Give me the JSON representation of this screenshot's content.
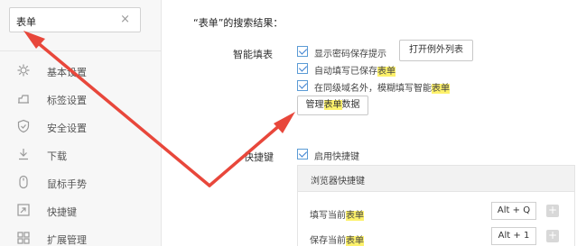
{
  "search": {
    "value": "表单",
    "clear": "×"
  },
  "sidebar": {
    "items": [
      {
        "label": "基本设置",
        "icon": "gear-icon"
      },
      {
        "label": "标签设置",
        "icon": "tab-icon"
      },
      {
        "label": "安全设置",
        "icon": "shield-icon"
      },
      {
        "label": "下载",
        "icon": "download-icon"
      },
      {
        "label": "鼠标手势",
        "icon": "mouse-icon"
      },
      {
        "label": "快捷键",
        "icon": "shortcut-icon"
      },
      {
        "label": "扩展管理",
        "icon": "extension-icon"
      }
    ]
  },
  "main": {
    "result_title": "“表单”的搜索结果：",
    "autofill": {
      "label": "智能填表",
      "opt1": "显示密码保存提示",
      "exceptions_button": "打开例外列表",
      "opt2_prefix": "自动填写已保存",
      "opt2_highlight": "表单",
      "opt3_prefix": "在同级域名外，模糊填写智能",
      "opt3_highlight": "表单",
      "manage_prefix": "管理",
      "manage_highlight": "表单",
      "manage_suffix": "数据"
    },
    "shortcuts": {
      "label": "快捷键",
      "enable": "启用快捷键",
      "header": "浏览器快捷键",
      "rows": [
        {
          "prefix": "填写当前",
          "highlight": "表单",
          "key": "Alt + Q"
        },
        {
          "prefix": "保存当前",
          "highlight": "表单",
          "key": "Alt + 1"
        }
      ]
    }
  },
  "colors": {
    "arrow": "#e8473b",
    "highlight": "#fdf16b",
    "checkbox": "#3a7fd0"
  }
}
